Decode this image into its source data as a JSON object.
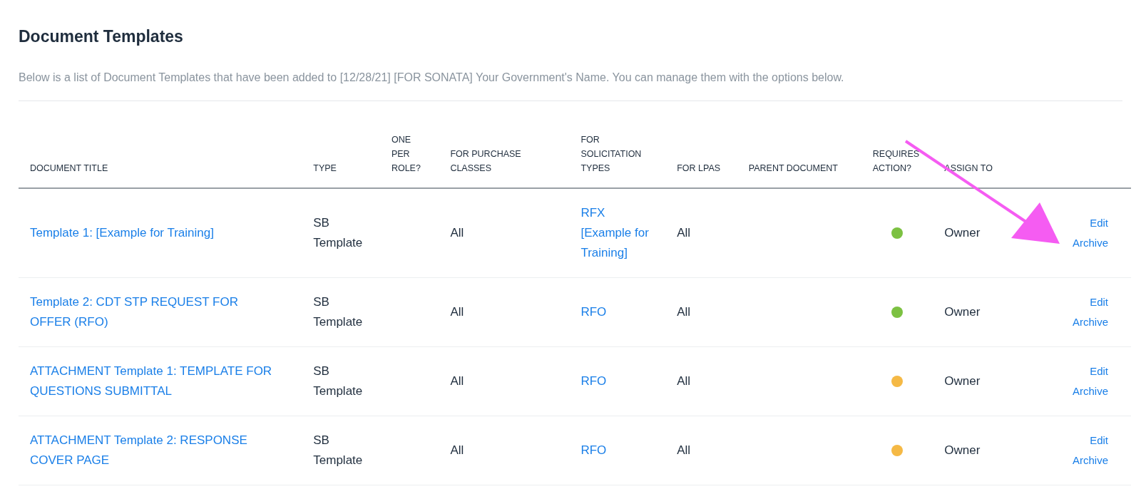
{
  "page": {
    "title": "Document Templates",
    "description": "Below is a list of Document Templates that have been added to [12/28/21] [FOR SONATA] Your Government's Name. You can manage them with the options below."
  },
  "table": {
    "columns": [
      "DOCUMENT TITLE",
      "TYPE",
      "ONE PER ROLE?",
      "FOR PURCHASE CLASSES",
      "FOR SOLICITATION TYPES",
      "FOR LPAS",
      "PARENT DOCUMENT",
      "REQUIRES ACTION?",
      "ASSIGN TO"
    ],
    "rows": [
      {
        "title": "Template 1: [Example for Training]",
        "type": "SB Template",
        "purchase_classes": "All",
        "solicitation_types": "RFX [Example for Training]",
        "lpas": "All",
        "color": "#7cc142",
        "assign_to": "Owner",
        "actions": [
          "Edit",
          "Archive"
        ]
      },
      {
        "title": "Template 2: CDT STP REQUEST FOR OFFER (RFO)",
        "type": "SB Template",
        "purchase_classes": "All",
        "solicitation_types": "RFO",
        "lpas": "All",
        "color": "#7cc142",
        "assign_to": "Owner",
        "actions": [
          "Edit",
          "Archive"
        ]
      },
      {
        "title": "ATTACHMENT Template 1: TEMPLATE FOR QUESTIONS SUBMITTAL",
        "type": "SB Template",
        "purchase_classes": "All",
        "solicitation_types": "RFO",
        "lpas": "All",
        "color": "#f5b945",
        "assign_to": "Owner",
        "actions": [
          "Edit",
          "Archive"
        ]
      },
      {
        "title": "ATTACHMENT Template 2: RESPONSE COVER PAGE",
        "type": "SB Template",
        "purchase_classes": "All",
        "solicitation_types": "RFO",
        "lpas": "All",
        "color": "#f5b945",
        "assign_to": "Owner",
        "actions": [
          "Edit",
          "Archive"
        ]
      }
    ]
  }
}
